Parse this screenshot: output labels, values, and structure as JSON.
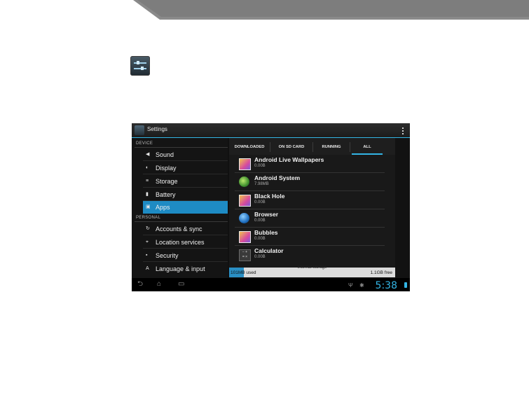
{
  "actionbar": {
    "title": "Settings"
  },
  "sections": {
    "device": "DEVICE",
    "personal": "PERSONAL"
  },
  "nav": [
    {
      "label": "Sound",
      "icon": "speaker-icon"
    },
    {
      "label": "Display",
      "icon": "display-icon"
    },
    {
      "label": "Storage",
      "icon": "storage-icon"
    },
    {
      "label": "Battery",
      "icon": "battery-icon"
    },
    {
      "label": "Apps",
      "icon": "apps-icon",
      "selected": true
    },
    {
      "label": "Accounts & sync",
      "icon": "sync-icon"
    },
    {
      "label": "Location services",
      "icon": "location-icon"
    },
    {
      "label": "Security",
      "icon": "lock-icon"
    },
    {
      "label": "Language & input",
      "icon": "language-icon"
    }
  ],
  "tabs": [
    "DOWNLOADED",
    "ON SD CARD",
    "RUNNING",
    "ALL"
  ],
  "selected_tab": "ALL",
  "apps": [
    {
      "name": "Android Live Wallpapers",
      "size": "0.00B",
      "icon": "picture-icon"
    },
    {
      "name": "Android System",
      "size": "7.98MB",
      "icon": "android-icon"
    },
    {
      "name": "Black Hole",
      "size": "0.00B",
      "icon": "picture-icon"
    },
    {
      "name": "Browser",
      "size": "0.00B",
      "icon": "globe-icon"
    },
    {
      "name": "Bubbles",
      "size": "0.00B",
      "icon": "picture-icon"
    },
    {
      "name": "Calculator",
      "size": "0.00B",
      "icon": "calculator-icon"
    }
  ],
  "storage": {
    "title": "Internal storage",
    "used": "101MB used",
    "free": "1.1GB free",
    "used_fraction": 0.09
  },
  "status": {
    "time": "5:38"
  },
  "colors": {
    "accent": "#33b5e5",
    "selected": "#1e8bc4"
  }
}
